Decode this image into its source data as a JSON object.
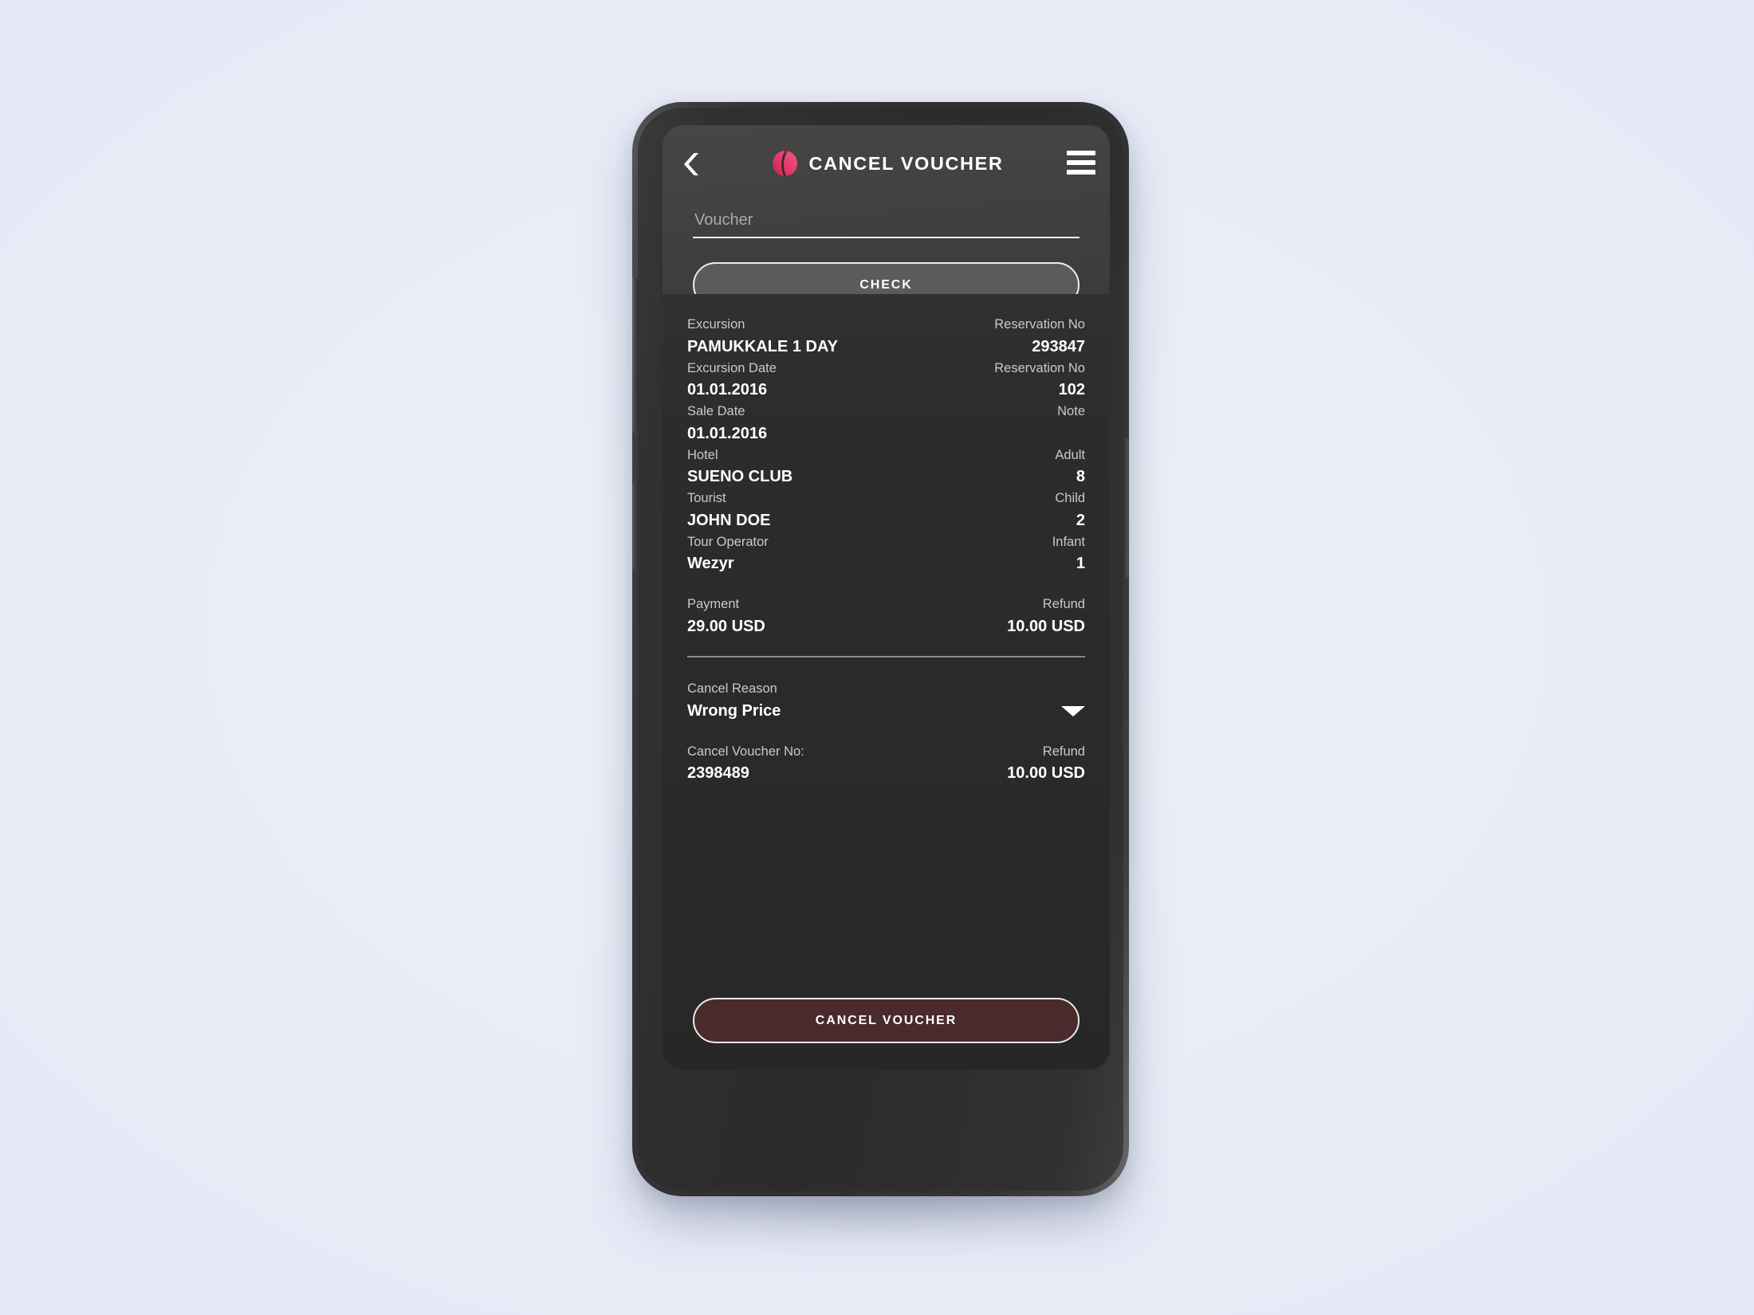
{
  "app": {
    "title": "CANCEL VOUCHER",
    "logo_icon": "brand-logo-icon",
    "back_icon": "chevron-left-icon",
    "menu_icon": "hamburger-menu-icon"
  },
  "colors": {
    "page_background": "#ebeff9",
    "header_background": "#434343",
    "body_background": "#2a2a2a",
    "brand_pink": "#e8376f",
    "brand_crimson": "#d6254e",
    "check_button_fill": "#5b5b5b",
    "cancel_button_fill": "#4a2a2c",
    "label_text": "#c9c9c9",
    "value_text": "#ffffff",
    "divider": "#8c8c8c"
  },
  "search": {
    "placeholder": "Voucher",
    "value": ""
  },
  "check_button": {
    "label": "CHECK"
  },
  "details": [
    {
      "left_label": "Excursion",
      "left_value": "PAMUKKALE 1 DAY",
      "right_label": "Reservation No",
      "right_value": "293847"
    },
    {
      "left_label": "Excursion Date",
      "left_value": "01.01.2016",
      "right_label": "Reservation No",
      "right_value": "102"
    },
    {
      "left_label": "Sale Date",
      "left_value": "01.01.2016",
      "right_label": "Note",
      "right_value": ""
    },
    {
      "left_label": "Hotel",
      "left_value": "SUENO CLUB",
      "right_label": "Adult",
      "right_value": "8"
    },
    {
      "left_label": "Tourist",
      "left_value": "JOHN DOE",
      "right_label": "Child",
      "right_value": "2"
    },
    {
      "left_label": "Tour Operator",
      "left_value": "Wezyr",
      "right_label": "Infant",
      "right_value": "1"
    }
  ],
  "totals": {
    "payment_label": "Payment",
    "payment_value": "29.00 USD",
    "refund_label": "Refund",
    "refund_value": "10.00 USD"
  },
  "cancel_section": {
    "reason_label": "Cancel Reason",
    "reason_value": "Wrong Price",
    "dropdown_icon": "caret-down-icon",
    "voucher_no_label": "Cancel Voucher No:",
    "voucher_no_value": "2398489",
    "refund_label": "Refund",
    "refund_value": "10.00 USD"
  },
  "cancel_button": {
    "label": "CANCEL VOUCHER"
  }
}
